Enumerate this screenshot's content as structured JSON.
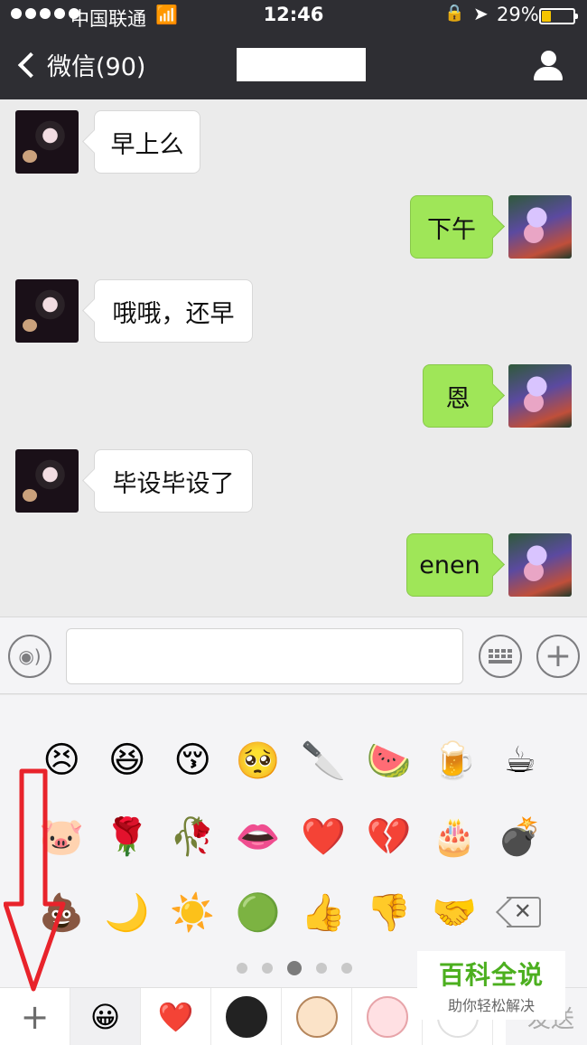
{
  "status_bar": {
    "carrier": "中国联通",
    "time": "12:46",
    "battery_percent_label": "29%",
    "battery_level": 0.29
  },
  "nav": {
    "back_label": "微信(90)",
    "unread_count": 90
  },
  "messages": [
    {
      "side": "left",
      "text": "早上么"
    },
    {
      "side": "right",
      "text": "下午"
    },
    {
      "side": "left",
      "text": "哦哦，还早"
    },
    {
      "side": "right",
      "text": "恩"
    },
    {
      "side": "left",
      "text": "毕设毕设了"
    },
    {
      "side": "right",
      "text": "enen"
    }
  ],
  "input": {
    "placeholder": ""
  },
  "emoji_panel": {
    "rows": [
      [
        "😣",
        "😆",
        "😚",
        "🥺",
        "🔪",
        "🍉",
        "🍺",
        "☕"
      ],
      [
        "🐷",
        "🌹",
        "🥀",
        "👄",
        "❤️",
        "💔",
        "🎂",
        "💣"
      ],
      [
        "💩",
        "🌙",
        "☀️",
        "🟢",
        "👍",
        "👎",
        "🤝",
        "delete"
      ]
    ],
    "page_count": 5,
    "active_page": 3
  },
  "tab_bar": {
    "tabs": [
      "add",
      "emoji",
      "heart",
      "sticker-1",
      "sticker-2",
      "sticker-3",
      "sticker-4"
    ],
    "add_symbol": "+",
    "emoji_symbol": "😀",
    "heart_symbol": "❤️",
    "send_partial": "发送"
  },
  "watermark": {
    "title": "百科全说",
    "subtitle": "助你轻松解决"
  },
  "colors": {
    "nav_bg": "#2e2e33",
    "chat_bg": "#ebebeb",
    "bubble_me": "#9fe658",
    "bubble_other": "#ffffff",
    "battery": "#f5c400",
    "annotation": "#e8232b",
    "watermark_green": "#4caf1f"
  }
}
